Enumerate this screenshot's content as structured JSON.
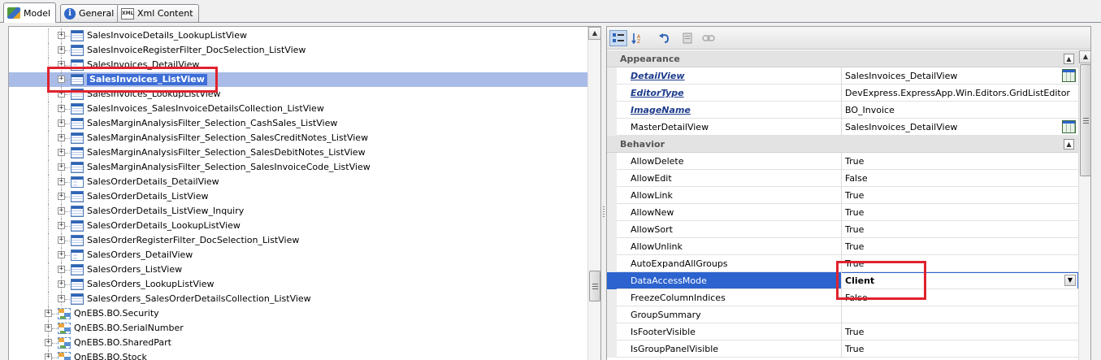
{
  "tabs": [
    {
      "label": "Model",
      "icon": "model-icon"
    },
    {
      "label": "General",
      "icon": "info-icon"
    },
    {
      "label": "Xml Content",
      "icon": "xml-icon"
    }
  ],
  "tree": {
    "items": [
      {
        "label": "SalesInvoiceDetails_LookupListView",
        "type": "listview"
      },
      {
        "label": "SalesInvoiceRegisterFilter_DocSelection_ListView",
        "type": "listview"
      },
      {
        "label": "SalesInvoices_DetailView",
        "type": "detailview"
      },
      {
        "label": "SalesInvoices_ListView",
        "type": "listview",
        "selected": true
      },
      {
        "label": "SalesInvoices_LookupListView",
        "type": "listview"
      },
      {
        "label": "SalesInvoices_SalesInvoiceDetailsCollection_ListView",
        "type": "listview"
      },
      {
        "label": "SalesMarginAnalysisFilter_Selection_CashSales_ListView",
        "type": "listview"
      },
      {
        "label": "SalesMarginAnalysisFilter_Selection_SalesCreditNotes_ListView",
        "type": "listview"
      },
      {
        "label": "SalesMarginAnalysisFilter_Selection_SalesDebitNotes_ListView",
        "type": "listview"
      },
      {
        "label": "SalesMarginAnalysisFilter_Selection_SalesInvoiceCode_ListView",
        "type": "listview"
      },
      {
        "label": "SalesOrderDetails_DetailView",
        "type": "detailview"
      },
      {
        "label": "SalesOrderDetails_ListView",
        "type": "listview"
      },
      {
        "label": "SalesOrderDetails_ListView_Inquiry",
        "type": "listview"
      },
      {
        "label": "SalesOrderDetails_LookupListView",
        "type": "listview"
      },
      {
        "label": "SalesOrderRegisterFilter_DocSelection_ListView",
        "type": "listview"
      },
      {
        "label": "SalesOrders_DetailView",
        "type": "detailview"
      },
      {
        "label": "SalesOrders_ListView",
        "type": "listview"
      },
      {
        "label": "SalesOrders_LookupListView",
        "type": "listview"
      },
      {
        "label": "SalesOrders_SalesOrderDetailsCollection_ListView",
        "type": "listview"
      },
      {
        "label": "QnEBS.BO.Security",
        "type": "namespace"
      },
      {
        "label": "QnEBS.BO.SerialNumber",
        "type": "namespace"
      },
      {
        "label": "QnEBS.BO.SharedPart",
        "type": "namespace"
      },
      {
        "label": "QnEBS.BO.Stock",
        "type": "namespace"
      }
    ]
  },
  "toolbar": {
    "buttons": [
      "categorized-icon",
      "sort-az-icon",
      "undo-icon",
      "properties-page-icon",
      "link-icon"
    ]
  },
  "properties": {
    "appearance": {
      "title": "Appearance",
      "rows": [
        {
          "name": "DetailView",
          "value": "SalesInvoices_DetailView",
          "link": true,
          "editor": true
        },
        {
          "name": "EditorType",
          "value": "DevExpress.ExpressApp.Win.Editors.GridListEditor",
          "link": true
        },
        {
          "name": "ImageName",
          "value": "BO_Invoice",
          "link": true
        },
        {
          "name": "MasterDetailView",
          "value": "SalesInvoices_DetailView",
          "editor": true
        }
      ]
    },
    "behavior": {
      "title": "Behavior",
      "rows": [
        {
          "name": "AllowDelete",
          "value": "True"
        },
        {
          "name": "AllowEdit",
          "value": "False"
        },
        {
          "name": "AllowLink",
          "value": "True"
        },
        {
          "name": "AllowNew",
          "value": "True"
        },
        {
          "name": "AllowSort",
          "value": "True"
        },
        {
          "name": "AllowUnlink",
          "value": "True"
        },
        {
          "name": "AutoExpandAllGroups",
          "value": "True"
        },
        {
          "name": "DataAccessMode",
          "value": "Client",
          "selected": true
        },
        {
          "name": "FreezeColumnIndices",
          "value": "False"
        },
        {
          "name": "GroupSummary",
          "value": ""
        },
        {
          "name": "IsFooterVisible",
          "value": "True"
        },
        {
          "name": "IsGroupPanelVisible",
          "value": "True"
        }
      ]
    }
  },
  "colors": {
    "selection": "#3d6dd6",
    "highlight_box": "#e0222e",
    "link_text": "#1e3c8c"
  }
}
